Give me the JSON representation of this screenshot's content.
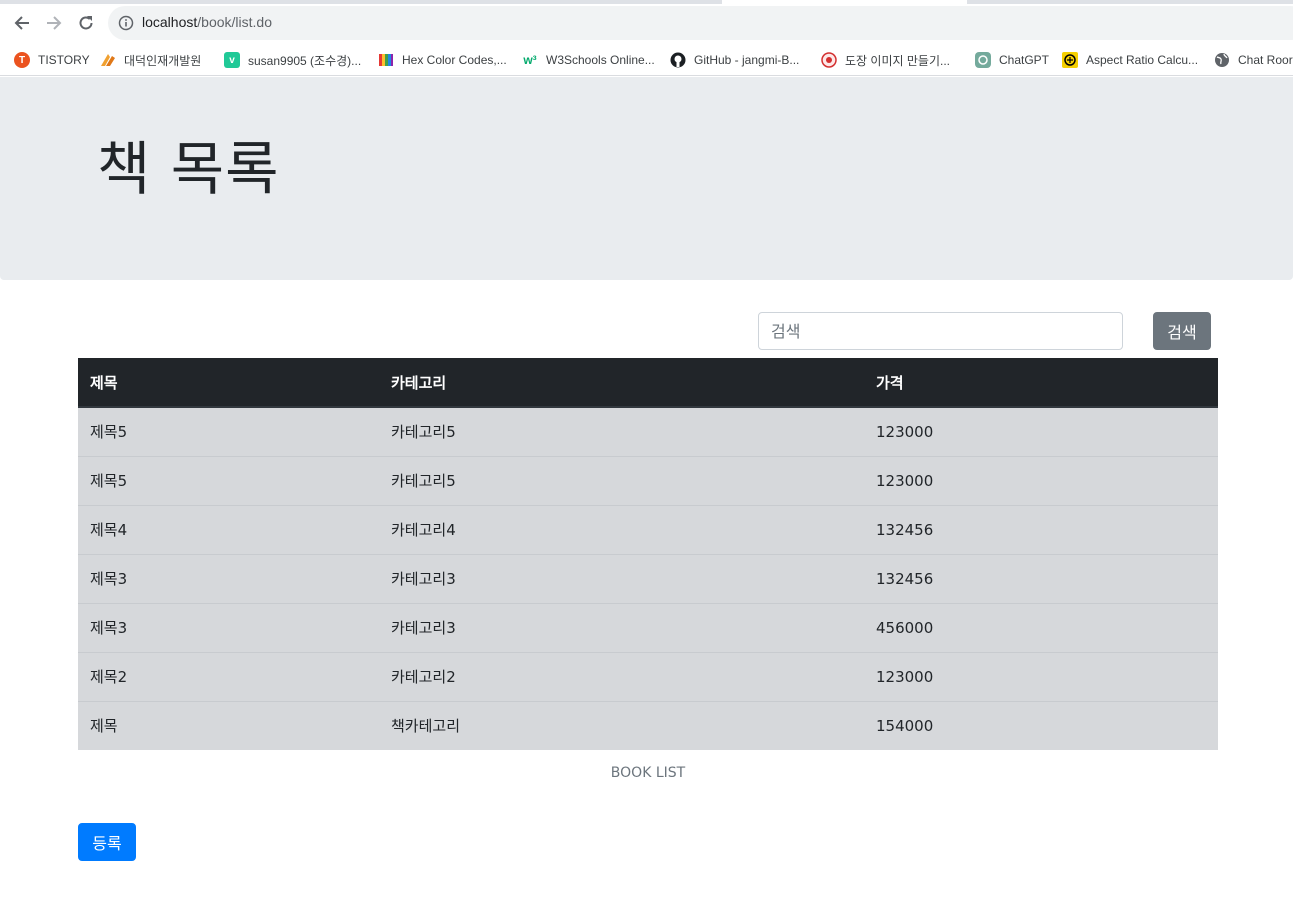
{
  "browser": {
    "url_host": "localhost",
    "url_path": "/book/list.do",
    "bookmarks": [
      {
        "label": "TISTORY",
        "icon": "tistory-icon"
      },
      {
        "label": "대덕인재개발원",
        "icon": "ddit-icon"
      },
      {
        "label": "susan9905 (조수경)...",
        "icon": "velog-icon"
      },
      {
        "label": "Hex Color Codes,...",
        "icon": "hexcolor-icon"
      },
      {
        "label": "W3Schools Online...",
        "icon": "w3schools-icon"
      },
      {
        "label": "GitHub - jangmi-B...",
        "icon": "github-icon"
      },
      {
        "label": "도장 이미지 만들기...",
        "icon": "stamp-icon"
      },
      {
        "label": "ChatGPT",
        "icon": "chatgpt-icon"
      },
      {
        "label": "Aspect Ratio Calcu...",
        "icon": "aspect-ratio-icon"
      },
      {
        "label": "Chat Roor",
        "icon": "globe-icon"
      }
    ]
  },
  "header": {
    "title": "책 목록"
  },
  "search": {
    "placeholder": "검색",
    "button_label": "검색"
  },
  "table": {
    "headers": [
      "제목",
      "카테고리",
      "가격"
    ],
    "rows": [
      [
        "제목5",
        "카테고리5",
        "123000"
      ],
      [
        "제목5",
        "카테고리5",
        "123000"
      ],
      [
        "제목4",
        "카테고리4",
        "132456"
      ],
      [
        "제목3",
        "카테고리3",
        "132456"
      ],
      [
        "제목3",
        "카테고리3",
        "456000"
      ],
      [
        "제목2",
        "카테고리2",
        "123000"
      ],
      [
        "제목",
        "책카테고리",
        "154000"
      ]
    ],
    "caption": "BOOK LIST"
  },
  "actions": {
    "register_label": "등록"
  },
  "colors": {
    "jumbotron_bg": "#e9ecef",
    "table_head_bg": "#212529",
    "table_row_bg": "#d6d8db",
    "secondary": "#6c757d",
    "primary": "#007bff"
  }
}
